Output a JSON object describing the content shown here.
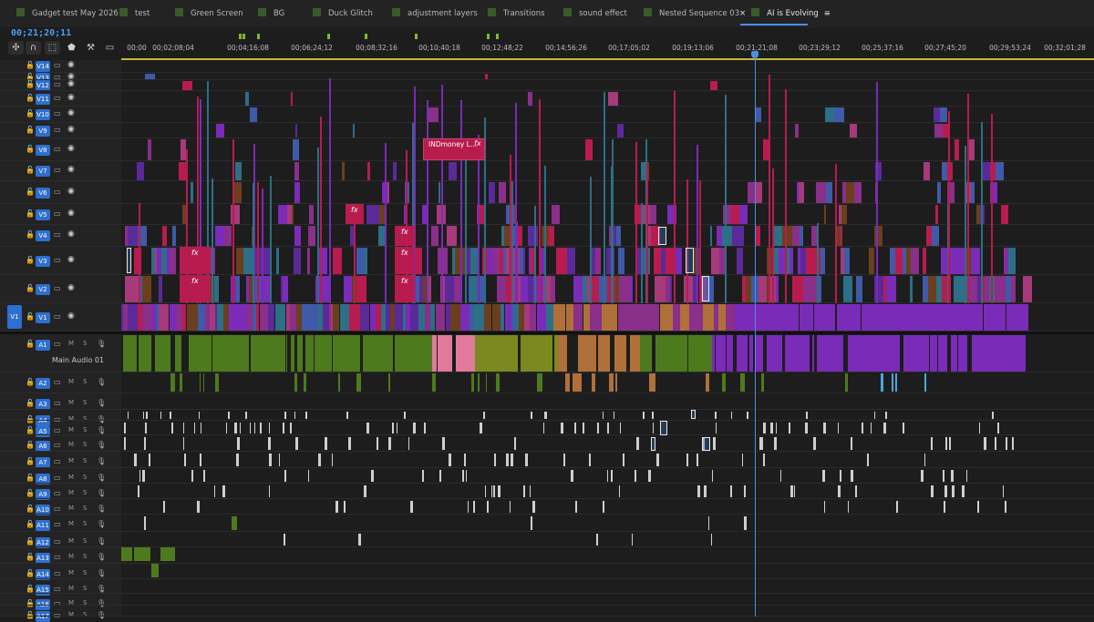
{
  "tabs": [
    {
      "label": "Gadget test May 2026",
      "color": "#3b5a2a"
    },
    {
      "label": "test",
      "color": "#3b5a2a"
    },
    {
      "label": "Green Screen",
      "color": "#3b5a2a"
    },
    {
      "label": "BG",
      "color": "#3b5a2a"
    },
    {
      "label": "Duck Glitch",
      "color": "#3b5a2a"
    },
    {
      "label": "adjustment layers",
      "color": "#3b5a2a"
    },
    {
      "label": "Transitions",
      "color": "#3b5a2a"
    },
    {
      "label": "sound effect",
      "color": "#3b5a2a"
    },
    {
      "label": "Nested Sequence 03",
      "color": "#3b5a2a"
    },
    {
      "label": "AI is Evolving",
      "color": "#3b5a2a",
      "active": true
    }
  ],
  "tab_close_glyph": "×",
  "tab_menu_glyph": "≡",
  "timecode": "00;21;20;11",
  "tools": [
    "snap-icon",
    "magnet-icon",
    "linked-selection-icon",
    "marker-icon",
    "wrench-icon",
    "captions-icon"
  ],
  "ruler_ticks": [
    "00;00",
    "00;02;08;04",
    "00;04;16;08",
    "00;06;24;12",
    "00;08;32;16",
    "00;10;40;18",
    "00;12;48;22",
    "00;14;56;26",
    "00;17;05;02",
    "00;19;13;06",
    "00;21;21;08",
    "00;23;29;12",
    "00;25;37;16",
    "00;27;45;20",
    "00;29;53;24",
    "00;32;01;28"
  ],
  "video_tracks": [
    "V14",
    "V13",
    "V12",
    "V11",
    "V10",
    "V9",
    "V8",
    "V7",
    "V6",
    "V5",
    "V4",
    "V3",
    "V2",
    "V1"
  ],
  "audio_tracks": [
    "A1",
    "A2",
    "A3",
    "A4",
    "A5",
    "A6",
    "A7",
    "A8",
    "A9",
    "A10",
    "A11",
    "A12",
    "A13",
    "A14",
    "A15",
    "A16",
    "A17"
  ],
  "source_patch_video": "V1",
  "source_patch_audio": "A1",
  "audio_track_name": "Main Audio 01",
  "m_label": "M",
  "s_label": "S",
  "ind_clip_label": "INDmoney L...",
  "fx_label": "fx",
  "colors": {
    "accent": "#2e6fd0",
    "playhead": "#4a90e2",
    "clip_magenta": "#b81c4f",
    "clip_purple": "#7a2bb8",
    "clip_teal": "#2c6f86",
    "clip_green": "#4e7a1e",
    "clip_orange": "#b0703a",
    "clip_pink": "#e07a9a"
  }
}
